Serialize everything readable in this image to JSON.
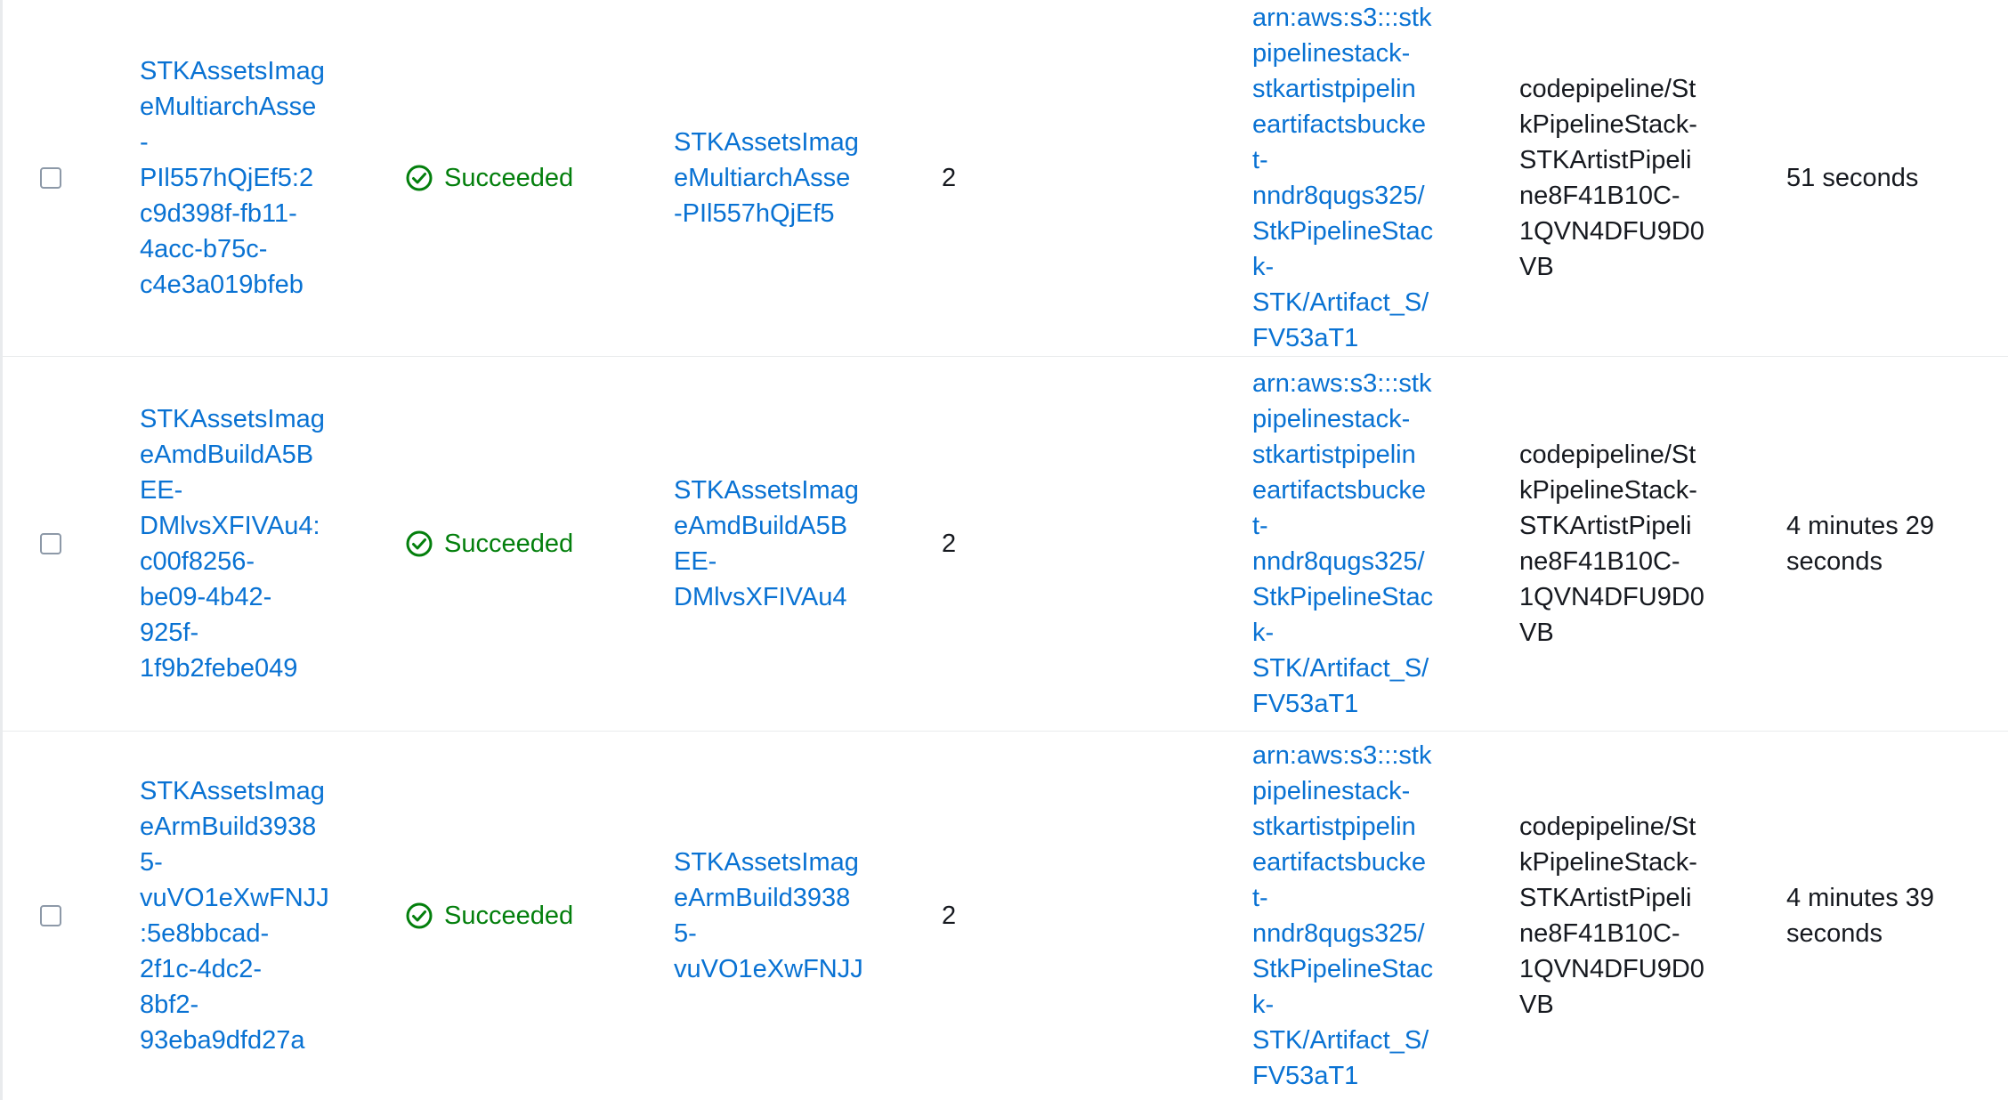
{
  "colors": {
    "link": "#0972d3",
    "success": "#037f0c",
    "text": "#16191f",
    "divider": "#e9ebed"
  },
  "rows": [
    {
      "id": "STKAssetsImag\neMultiarchAsse\n-\nPIl557hQjEf5:2\nc9d398f-fb11-\n4acc-b75c-\nc4e3a019bfeb",
      "status": "Succeeded",
      "status_icon": "check-circle-icon",
      "name": "STKAssetsImag\neMultiarchAsse\n-PIl557hQjEf5",
      "number": "2",
      "arn": "arn:aws:s3:::stk\npipelinestack-\nstkartistpipelin\neartifactsbucke\nt-\nnndr8qugs325/\nStkPipelineStac\nk-\nSTK/Artifact_S/\nFV53aT1",
      "log_group": "codepipeline/St\nkPipelineStack-\nSTKArtistPipeli\nne8F41B10C-\n1QVN4DFU9D0\nVB",
      "duration": "51 seconds"
    },
    {
      "id": "STKAssetsImag\neAmdBuildA5B\nEE-\nDMlvsXFIVAu4:\nc00f8256-\nbe09-4b42-\n925f-\n1f9b2febe049",
      "status": "Succeeded",
      "status_icon": "check-circle-icon",
      "name": "STKAssetsImag\neAmdBuildA5B\nEE-\nDMlvsXFIVAu4",
      "number": "2",
      "arn": "arn:aws:s3:::stk\npipelinestack-\nstkartistpipelin\neartifactsbucke\nt-\nnndr8qugs325/\nStkPipelineStac\nk-\nSTK/Artifact_S/\nFV53aT1",
      "log_group": "codepipeline/St\nkPipelineStack-\nSTKArtistPipeli\nne8F41B10C-\n1QVN4DFU9D0\nVB",
      "duration": "4 minutes 29\nseconds"
    },
    {
      "id": "STKAssetsImag\neArmBuild3938\n5-\nvuVO1eXwFNJJ\n:5e8bbcad-\n2f1c-4dc2-\n8bf2-\n93eba9dfd27a",
      "status": "Succeeded",
      "status_icon": "check-circle-icon",
      "name": "STKAssetsImag\neArmBuild3938\n5-\nvuVO1eXwFNJJ",
      "number": "2",
      "arn": "arn:aws:s3:::stk\npipelinestack-\nstkartistpipelin\neartifactsbucke\nt-\nnndr8qugs325/\nStkPipelineStac\nk-\nSTK/Artifact_S/\nFV53aT1",
      "log_group": "codepipeline/St\nkPipelineStack-\nSTKArtistPipeli\nne8F41B10C-\n1QVN4DFU9D0\nVB",
      "duration": "4 minutes 39\nseconds"
    }
  ]
}
